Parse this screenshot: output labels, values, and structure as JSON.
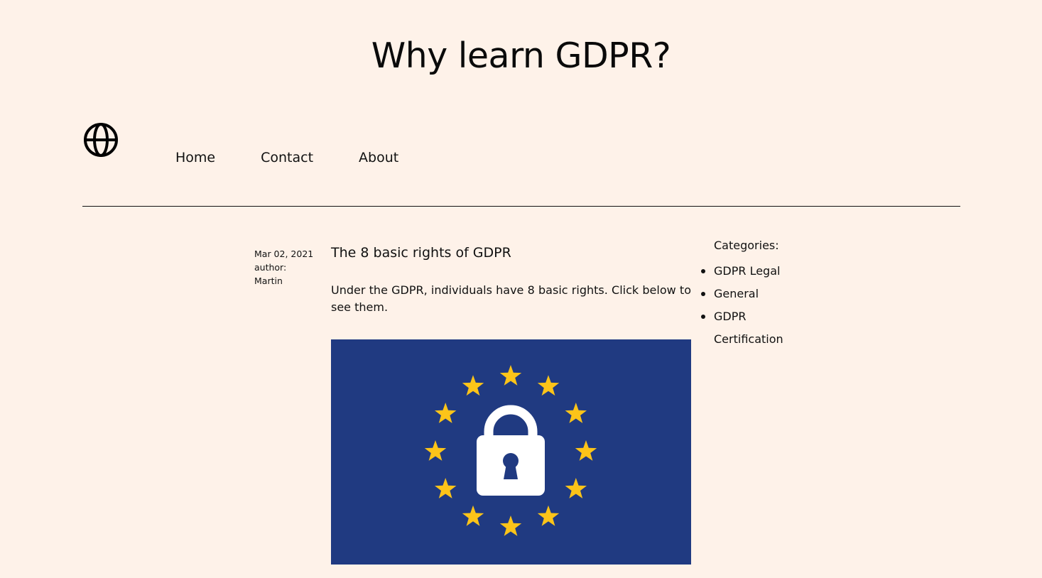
{
  "header": {
    "site_title": "Why learn GDPR?"
  },
  "nav": {
    "items": [
      {
        "label": "Home"
      },
      {
        "label": "Contact"
      },
      {
        "label": "About"
      }
    ]
  },
  "post": {
    "date": "Mar 02, 2021",
    "author_label": "author:",
    "author_name": "Martin",
    "title": "The 8 basic rights of GDPR",
    "excerpt": "Under the GDPR, individuals have 8 basic rights. Click below to see them.",
    "image": {
      "background_color": "#203a81",
      "star_color": "#fcc419",
      "lock_color": "#ffffff",
      "icons": [
        "eu-star-icon",
        "padlock-icon"
      ]
    }
  },
  "sidebar": {
    "heading": "Categories:",
    "categories": [
      "GDPR Legal",
      "General",
      "GDPR Certification"
    ]
  },
  "colors": {
    "page_background": "#fef2e9",
    "text": "#111111"
  }
}
